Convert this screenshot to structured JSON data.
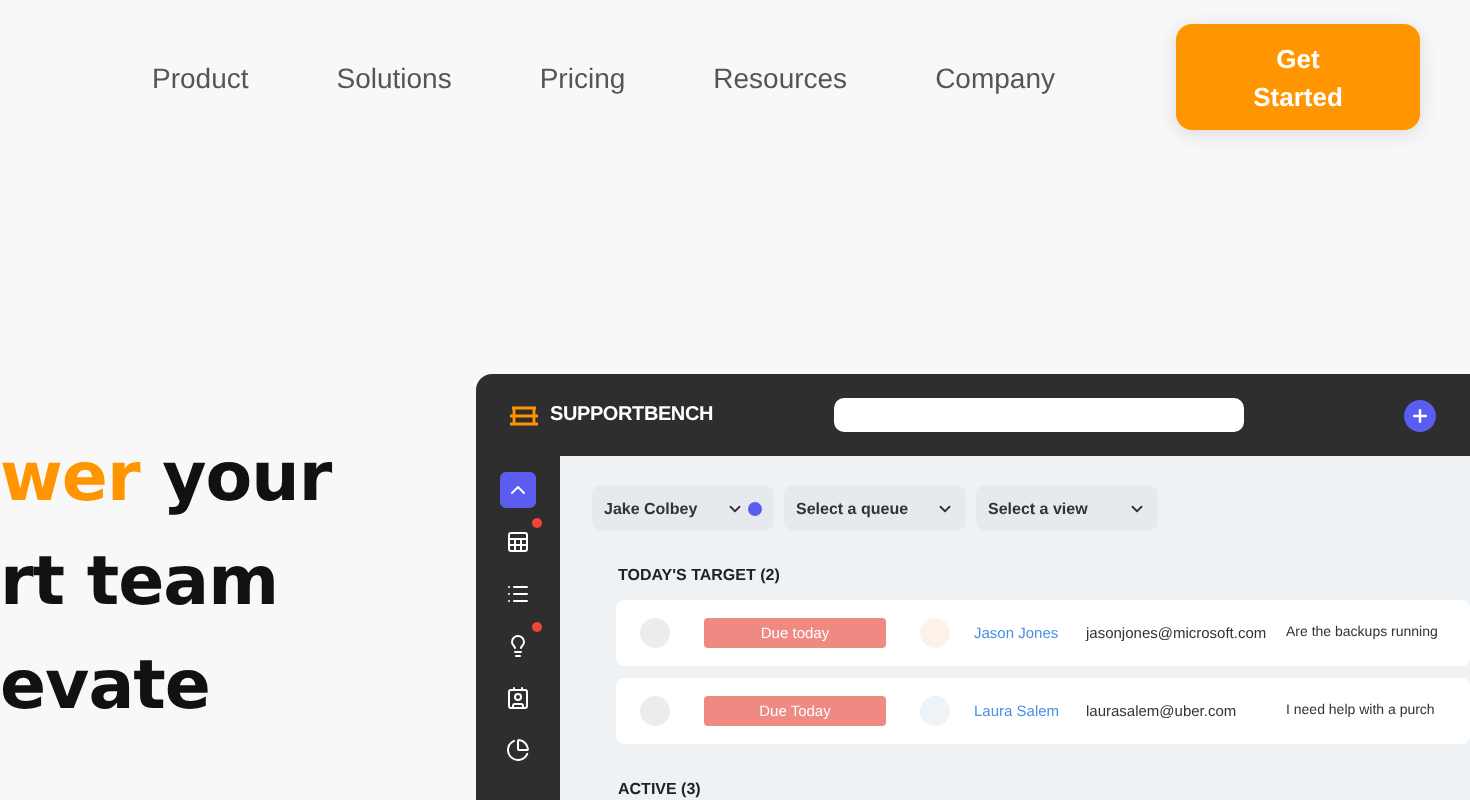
{
  "nav": {
    "items": [
      "Product",
      "Solutions",
      "Pricing",
      "Resources",
      "Company"
    ],
    "cta": "Get Started"
  },
  "headline": {
    "lines": [
      {
        "accent": "wer",
        "text": "your"
      },
      {
        "text": "rt team"
      },
      {
        "text": "evate"
      }
    ]
  },
  "app": {
    "brand": "SUPPORTBENCH",
    "sidebar": [
      {
        "selected": true,
        "badge": false
      },
      {
        "selected": false,
        "badge": true
      },
      {
        "selected": false,
        "badge": false
      },
      {
        "selected": false,
        "badge": true
      },
      {
        "selected": false,
        "badge": false
      },
      {
        "selected": false,
        "badge": false
      }
    ],
    "filters": [
      {
        "label": "Jake Colbey",
        "badge": true
      },
      {
        "label": "Select a queue",
        "badge": false
      },
      {
        "label": "Select a view",
        "badge": false
      }
    ],
    "sections": [
      {
        "title": "TODAY'S TARGET (2)",
        "rows": [
          {
            "status": "Due today",
            "color": "#fdf1ea",
            "name": "Jason Jones",
            "email": "jasonjones@microsoft.com",
            "subject": "Are the backups running"
          },
          {
            "status": "Due Today",
            "color": "#eef3f8",
            "name": "Laura Salem",
            "email": "laurasalem@uber.com",
            "subject": "I need help with a purch"
          }
        ]
      },
      {
        "title": "ACTIVE (3)"
      }
    ]
  }
}
